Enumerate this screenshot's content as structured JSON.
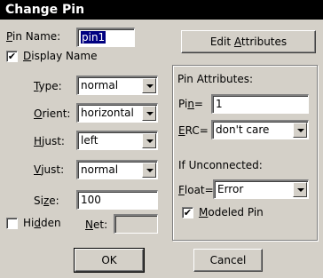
{
  "window": {
    "title": "Change Pin"
  },
  "left": {
    "pin_name_label": "Pin Name:",
    "pin_name_value": "pin1",
    "display_name_label": "Display Name",
    "display_name_checked": true,
    "type_label": "Type:",
    "type_value": "normal",
    "orient_label": "Orient:",
    "orient_value": "horizontal",
    "hjust_label": "Hjust:",
    "hjust_value": "left",
    "vjust_label": "Vjust:",
    "vjust_value": "normal",
    "size_label": "Size:",
    "size_value": "100",
    "hidden_label": "Hidden",
    "hidden_checked": false,
    "net_label": "Net:",
    "net_value": ""
  },
  "right": {
    "edit_attributes_label": "Edit Attributes",
    "group_title": "Pin Attributes:",
    "pin_label": "Pin=",
    "pin_value": "1",
    "erc_label": "ERC=",
    "erc_value": "don't care",
    "if_unconnected_label": "If Unconnected:",
    "float_label": "Float=",
    "float_value": "Error",
    "modeled_pin_label": "Modeled Pin",
    "modeled_pin_checked": true
  },
  "buttons": {
    "ok": "OK",
    "cancel": "Cancel"
  },
  "glyphs": {
    "check": "✔"
  }
}
